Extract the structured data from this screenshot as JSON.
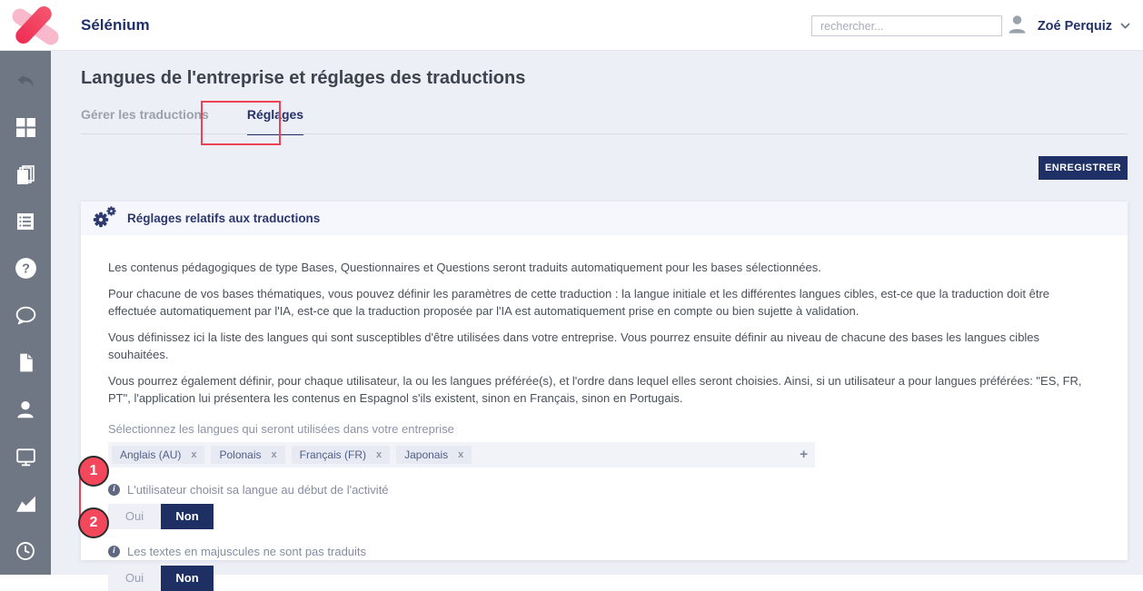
{
  "colors": {
    "accent_navy": "#1e3066",
    "annotation_red": "#ee4156",
    "sidebar_gray": "#6f7684",
    "brand_pink": "#ef2d55",
    "brand_pink_light": "#f7b9cb",
    "page_background": "#edeff6"
  },
  "header": {
    "app_title": "Sélénium",
    "search_placeholder": "rechercher...",
    "user_name": "Zoé Perquiz"
  },
  "sidebar": {
    "items": [
      "undo-arrow",
      "dashboard-grid",
      "pages",
      "list",
      "help",
      "chat-bubble",
      "document",
      "user",
      "monitor",
      "chart",
      "clock"
    ]
  },
  "icons": {
    "question_glyph": "?",
    "info_glyph": "i",
    "plus_glyph": "+",
    "remove_glyph": "x"
  },
  "page": {
    "title": "Langues de l'entreprise et réglages des traductions",
    "tabs": [
      {
        "label": "Gérer les traductions",
        "active": false
      },
      {
        "label": "Réglages",
        "active": true
      }
    ],
    "save_button": "ENREGISTRER"
  },
  "settings_card": {
    "title": "Réglages relatifs aux traductions",
    "paragraphs": [
      "Les contenus pédagogiques de type Bases, Questionnaires et Questions seront traduits automatiquement pour les bases sélectionnées.",
      "Pour chacune de vos bases thématiques, vous pouvez définir les paramètres de cette traduction : la langue initiale et les différentes langues cibles, est-ce que la traduction doit être effectuée automatiquement par l'IA, est-ce que la traduction proposée par l'IA est automatiquement prise en compte ou bien sujette à validation.",
      "Vous définissez ici la liste des langues qui sont susceptibles d'être utilisées dans votre entreprise. Vous pourrez ensuite définir au niveau de chacune des bases les langues cibles souhaitées.",
      "Vous pourrez également définir, pour chaque utilisateur, la ou les langues préférée(s), et l'ordre dans lequel elles seront choisies. Ainsi, si un utilisateur a pour langues préférées: \"ES, FR, PT\", l'application lui présentera les contenus en Espagnol s'ils existent, sinon en Français, sinon en Portugais."
    ],
    "languages_label": "Sélectionnez les langues qui seront utilisées dans votre entreprise",
    "languages": [
      "Anglais (AU)",
      "Polonais",
      "Français (FR)",
      "Japonais"
    ],
    "toggles": [
      {
        "label": "L'utilisateur choisit sa langue au début de l'activité",
        "yes": "Oui",
        "no": "Non",
        "selected": "Non"
      },
      {
        "label": "Les textes en majuscules ne sont pas traduits",
        "yes": "Oui",
        "no": "Non",
        "selected": "Non"
      }
    ]
  },
  "annotations": {
    "step_1": "1",
    "step_2": "2"
  }
}
